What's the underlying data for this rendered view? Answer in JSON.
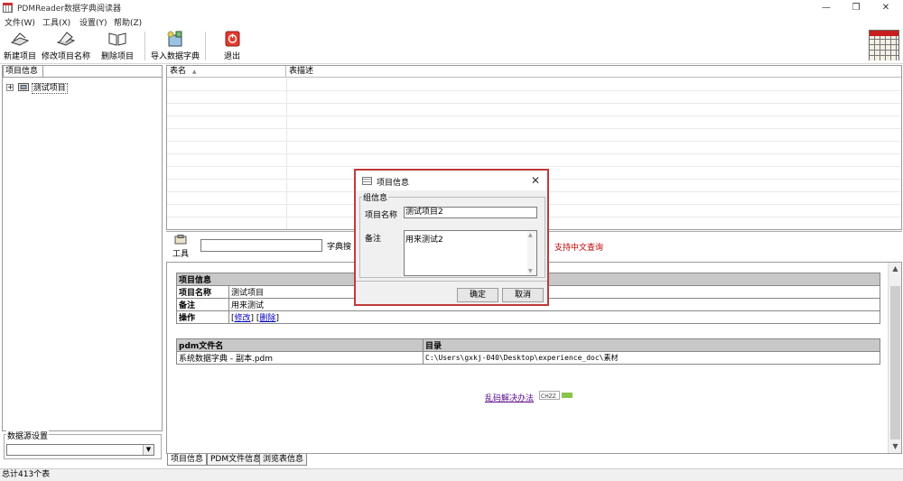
{
  "window": {
    "title": "PDMReader数据字典阅读器",
    "controls": {
      "minimize": "—",
      "restore": "❐",
      "close": "✕"
    }
  },
  "menu": [
    "文件(W)",
    "工具(X)",
    "设置(Y)",
    "帮助(Z)"
  ],
  "toolbar": {
    "new_project": "新建项目",
    "rename_project": "修改项目名称",
    "delete_project": "删除项目",
    "import_dict": "导入数据字典",
    "exit": "退出"
  },
  "left_panel": {
    "tab": "项目信息",
    "tree": [
      {
        "expander": "+",
        "label": "测试项目"
      }
    ],
    "datasource_group": "数据源设置",
    "datasource_value": ""
  },
  "table_list": {
    "columns": [
      "表名",
      "表描述"
    ],
    "sort_indicator": "▲"
  },
  "search": {
    "tool_label": "工具",
    "query_value": "",
    "button": "字典搜",
    "support_link": "支持中文查询"
  },
  "detail": {
    "project_info": {
      "header": "项目信息",
      "rows": [
        {
          "key": "项目名称",
          "value": "测试项目"
        },
        {
          "key": "备注",
          "value": "用来测试"
        }
      ],
      "ops_key": "操作",
      "ops": [
        "修改",
        "删除"
      ]
    },
    "files": {
      "columns": [
        "pdm文件名",
        "目录"
      ],
      "rows": [
        {
          "file": "系统数据字典 - 副本.pdm",
          "dir": "C:\\Users\\gxkj-040\\Desktop\\experience_doc\\素材"
        }
      ]
    },
    "garbled_link": "乱码解决办法",
    "flag_chip": "CHZZ"
  },
  "bottom_tabs": [
    "项目信息",
    "PDM文件信息",
    "浏览表信息"
  ],
  "status": "总计413个表",
  "dialog": {
    "title": "项目信息",
    "group": "组信息",
    "name_label": "项目名称",
    "name_value": "测试项目2",
    "remark_label": "备注",
    "remark_value": "用来测试2",
    "ok": "确定",
    "cancel": "取消"
  },
  "colors": {
    "accent_red": "#c00000",
    "dialog_border": "#c03a3a",
    "link_blue": "#0000c0"
  }
}
